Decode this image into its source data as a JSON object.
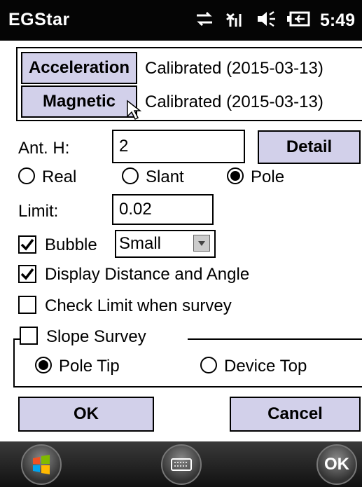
{
  "app_title": "EGStar",
  "status": {
    "time": "5:49"
  },
  "calibration": {
    "acceleration_button": "Acceleration",
    "acceleration_status": "Calibrated (2015-03-13)",
    "magnetic_button": "Magnetic",
    "magnetic_status": "Calibrated (2015-03-13)"
  },
  "antenna": {
    "label": "Ant. H:",
    "value": "2",
    "detail_button": "Detail",
    "modes": [
      "Real",
      "Slant",
      "Pole"
    ],
    "selected_mode": "Pole"
  },
  "limit": {
    "label": "Limit:",
    "value": "0.02"
  },
  "bubble": {
    "label": "Bubble",
    "checked": true,
    "size_value": "Small"
  },
  "options": {
    "display_distance_angle": "Display Distance and Angle",
    "display_distance_angle_checked": true,
    "check_limit": "Check Limit when survey",
    "check_limit_checked": false
  },
  "slope": {
    "label": "Slope Survey",
    "checked": false,
    "choices": [
      "Pole Tip",
      "Device Top"
    ],
    "selected": "Pole Tip"
  },
  "dialog": {
    "ok": "OK",
    "cancel": "Cancel"
  },
  "taskbar": {
    "ok": "OK"
  }
}
